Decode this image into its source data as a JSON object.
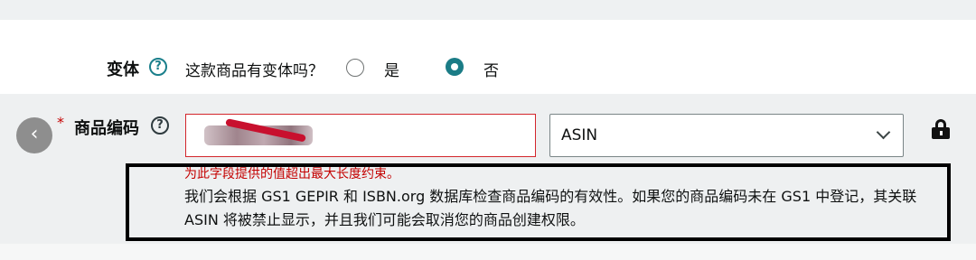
{
  "variation": {
    "label": "变体",
    "question": "这款商品有变体吗？",
    "option_yes": "是",
    "option_no": "否",
    "selected": "否"
  },
  "product_code": {
    "label": "商品编码",
    "required_marker": "*",
    "input_value": "",
    "type_selected": "ASIN",
    "error": "为此字段提供的值超出最大长度约束。",
    "info": "我们会根据 GS1 GEPIR 和 ISBN.org 数据库检查商品编码的有效性。如果您的商品编码未在 GS1 中登记，其关联 ASIN 将被禁止显示，并且我们可能会取消您的商品创建权限。"
  },
  "icons": {
    "help": "help-circle-icon",
    "back": "chevron-left-icon",
    "dropdown": "chevron-down-icon",
    "lock": "lock-icon"
  },
  "colors": {
    "accent": "#1b7c86",
    "error": "#c40000",
    "panel": "#eef0f1"
  }
}
